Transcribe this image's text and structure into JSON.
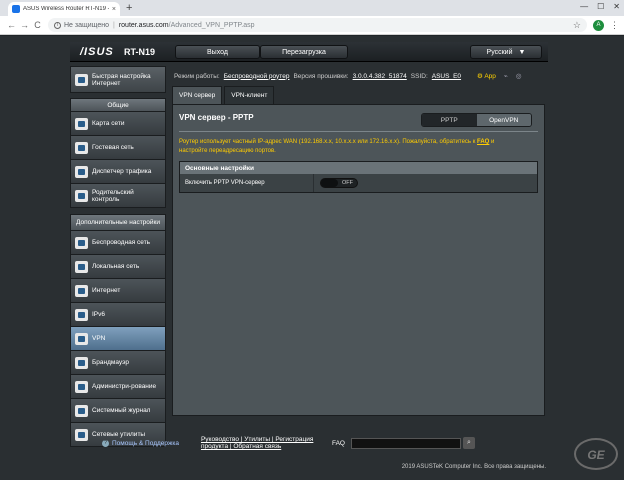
{
  "browser": {
    "tab_title": "ASUS Wireless Router RT-N19 -",
    "tab_close": "×",
    "new_tab": "+",
    "min": "—",
    "max": "☐",
    "close": "✕",
    "back": "←",
    "forward": "→",
    "reload": "C",
    "not_secure": "Не защищено",
    "host": "router.asus.com",
    "path": "/Advanced_VPN_PPTP.asp",
    "star": "☆",
    "avatar_letter": "A",
    "menu": "⋮"
  },
  "router": {
    "logo": "/ISUS",
    "model": "RT-N19",
    "logout": "Выход",
    "reboot": "Перезагрузка",
    "language": "Русский",
    "language_caret": "▼"
  },
  "sidebar": {
    "quick_setup": "Быстрая настройка Интернет",
    "general_header": "Общие",
    "general_items": [
      {
        "label": "Карта сети",
        "icon": "network-map-icon"
      },
      {
        "label": "Гостевая сеть",
        "icon": "guest-network-icon"
      },
      {
        "label": "Диспетчер трафика",
        "icon": "traffic-manager-icon"
      },
      {
        "label": "Родительский контроль",
        "icon": "parental-control-icon"
      }
    ],
    "advanced_header": "Дополнительные настройки",
    "advanced_items": [
      {
        "label": "Беспроводная сеть",
        "icon": "wireless-icon"
      },
      {
        "label": "Локальная сеть",
        "icon": "lan-icon"
      },
      {
        "label": "Интернет",
        "icon": "wan-icon"
      },
      {
        "label": "IPv6",
        "icon": "ipv6-icon"
      },
      {
        "label": "VPN",
        "icon": "vpn-icon",
        "active": true
      },
      {
        "label": "Брандмауэр",
        "icon": "firewall-icon"
      },
      {
        "label": "Администри-рование",
        "icon": "administration-icon"
      },
      {
        "label": "Системный журнал",
        "icon": "system-log-icon"
      },
      {
        "label": "Сетевые утилиты",
        "icon": "network-tools-icon"
      }
    ]
  },
  "status": {
    "mode_label": "Режим работы:",
    "mode_value": "Беспроводной роутер",
    "firmware_label": "Версия прошивки:",
    "firmware_value": "3.0.0.4.382_51874",
    "ssid_label": "SSID:",
    "ssid_value": "ASUS_E0",
    "app_label": "App"
  },
  "tabs": {
    "vpn_server": "VPN сервер",
    "vpn_client": "VPN-клиент"
  },
  "panel": {
    "title": "VPN сервер - PPTP",
    "seg_pptp": "PPTP",
    "seg_openvpn": "OpenVPN",
    "warning_pre": "Роутер использует частный IP-адрес WAN (192.168.x.x, 10.x.x.x или 172.16.x.x). Пожалуйста, обратитесь к ",
    "warning_faq": "FAQ",
    "warning_post": " и настройте переадресацию портов.",
    "table_header": "Основные настройки",
    "enable_label": "Включить PPTP VPN-сервер",
    "toggle_state": "OFF"
  },
  "footer": {
    "help": "Помощь & Поддержка",
    "links_line1": "Руководство | Утилиты | Регистрация",
    "links_line2": "продукта | Обратная связь",
    "faq_label": "FAQ",
    "search_glyph": "⌕",
    "copyright": "2019 ASUSTeK Computer Inc. Все права защищены.",
    "watermark": "GE"
  }
}
